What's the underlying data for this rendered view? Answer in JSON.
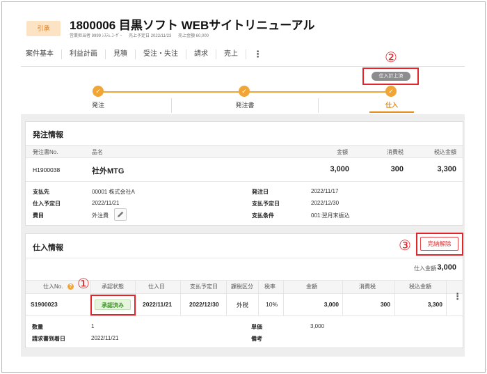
{
  "header": {
    "badge": "引承",
    "title": "1800006 目黒ソフト WEBサイトリニューアル",
    "meta": [
      "営業担当者 9999 ｼｽﾃﾑ ﾕｰｻﾞｰ",
      "売上予定日 2022/11/23",
      "売上金額 60,000"
    ]
  },
  "tabs": [
    "案件基本",
    "利益計画",
    "見積",
    "受注・失注",
    "請求",
    "売上"
  ],
  "tabs_more": "⋮",
  "status_chip": "仕入計上済",
  "steps": [
    {
      "label": "発注",
      "active": false
    },
    {
      "label": "発注書",
      "active": false
    },
    {
      "label": "仕入",
      "active": true
    }
  ],
  "check_icon": "✓",
  "order": {
    "title": "発注情報",
    "columns": [
      "発注書No.",
      "品名",
      "金額",
      "消費税",
      "税込金額"
    ],
    "row": {
      "no": "H1900038",
      "name": "社外MTG",
      "amount": "3,000",
      "tax": "300",
      "total": "3,300"
    },
    "details_left": [
      {
        "label": "支払先",
        "value": "00001  株式会社A"
      },
      {
        "label": "仕入予定日",
        "value": "2022/11/21"
      },
      {
        "label": "費目",
        "value": "外注費"
      }
    ],
    "details_right": [
      {
        "label": "発注日",
        "value": "2022/11/17"
      },
      {
        "label": "支払予定日",
        "value": "2022/12/30"
      },
      {
        "label": "支払条件",
        "value": "001:翌月末振込"
      }
    ]
  },
  "purchase": {
    "title": "仕入情報",
    "cancel_button": "完納解除",
    "total_label": "仕入金額",
    "total_value": "3,000",
    "columns": [
      "仕入No.",
      "承認状態",
      "仕入日",
      "支払予定日",
      "課税区分",
      "税率",
      "金額",
      "消費税",
      "税込金額"
    ],
    "row": {
      "no": "S1900023",
      "status": "承認済み",
      "date": "2022/11/21",
      "pay_date": "2022/12/30",
      "tax_type": "外税",
      "rate": "10%",
      "amount": "3,000",
      "tax": "300",
      "total": "3,300"
    },
    "details_left": [
      {
        "label": "数量",
        "value": "1"
      },
      {
        "label": "請求書到着日",
        "value": "2022/11/21"
      }
    ],
    "details_right": [
      {
        "label": "単価",
        "value": "3,000"
      },
      {
        "label": "備考",
        "value": ""
      }
    ]
  },
  "annotations": [
    "①",
    "②",
    "③"
  ],
  "colors": {
    "accent": "#f1a534",
    "annotation": "#e0262a",
    "approved": "#3f9a26"
  }
}
